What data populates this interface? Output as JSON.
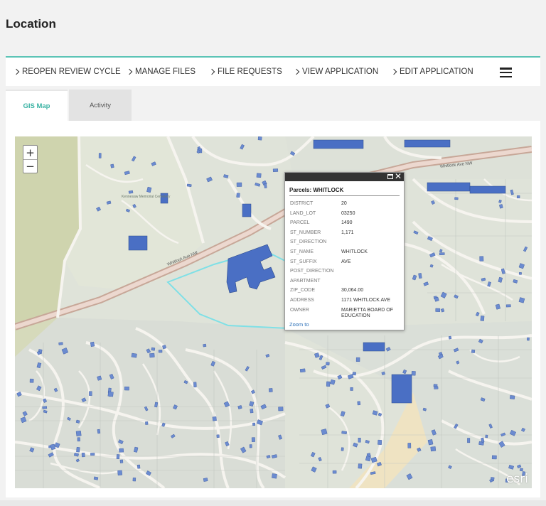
{
  "page": {
    "title": "Location"
  },
  "actions": {
    "reopen": "REOPEN REVIEW CYCLE",
    "manage_files": "MANAGE FILES",
    "file_requests": "FILE REQUESTS",
    "view_application": "VIEW APPLICATION",
    "edit_application": "EDIT APPLICATION",
    "menu_icon": "hamburger-icon"
  },
  "tabs": {
    "gis_map": "GIS Map",
    "activity": "Activity",
    "active": "GIS Map"
  },
  "map": {
    "zoom_in": "+",
    "zoom_out": "−",
    "attribution": "esri",
    "labels": {
      "whitlock_ave_nw_left": "Whitlock Ave NW",
      "whitlock_ave_nw_right": "Whitlock Ave NW",
      "cemetery": "Kennesaw Memorial Cemetery"
    },
    "popup": {
      "title": "Parcels: WHITLOCK",
      "rows": [
        {
          "key": "DISTRICT",
          "value": "20"
        },
        {
          "key": "LAND_LOT",
          "value": "03250"
        },
        {
          "key": "PARCEL",
          "value": "1490"
        },
        {
          "key": "ST_NUMBER",
          "value": "1,171"
        },
        {
          "key": "ST_DIRECTION",
          "value": ""
        },
        {
          "key": "ST_NAME",
          "value": "WHITLOCK"
        },
        {
          "key": "ST_SUFFIX",
          "value": "AVE"
        },
        {
          "key": "POST_DIRECTION",
          "value": ""
        },
        {
          "key": "APARTMENT",
          "value": ""
        },
        {
          "key": "ZIP_CODE",
          "value": "30,064.00"
        },
        {
          "key": "ADDRESS",
          "value": "1171 WHITLOCK AVE"
        },
        {
          "key": "OWNER",
          "value": "MARIETTA BOARD OF EDUCATION"
        }
      ],
      "zoom_to": "Zoom to"
    }
  },
  "colors": {
    "accent": "#5cc4b6",
    "tab_active_text": "#3bb3a4",
    "building": "#4a6fc4",
    "road": "#f4f2ee",
    "highway": "#d9b7a6",
    "park": "#cfd4ae",
    "selection": "#7fe0e6"
  }
}
